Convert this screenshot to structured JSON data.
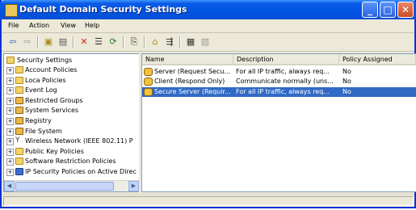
{
  "window": {
    "title": "Default Domain Security Settings",
    "minimize_label": "_",
    "maximize_label": "□",
    "close_label": "✕"
  },
  "menu": {
    "items": [
      "File",
      "Action",
      "View",
      "Help"
    ]
  },
  "toolbar": {
    "icons": [
      "back-arrow-icon",
      "forward-arrow-icon",
      "up-folder-icon",
      "show-hide-tree-icon",
      "delete-icon",
      "properties-icon",
      "refresh-icon",
      "export-list-icon",
      "help-icon",
      "add-policy-icon",
      "assign-policy-icon",
      "manage-filters-icon",
      "unassign-icon"
    ]
  },
  "tree": {
    "root": "Security Settings",
    "items": [
      {
        "label": "Account Policies",
        "icon": "folder",
        "expand": "+"
      },
      {
        "label": "Loca Policies",
        "icon": "folder",
        "expand": "+"
      },
      {
        "label": "Event Log",
        "icon": "folder",
        "expand": "+"
      },
      {
        "label": "Restricted Groups",
        "icon": "policy",
        "expand": "+"
      },
      {
        "label": "System Services",
        "icon": "policy",
        "expand": "+"
      },
      {
        "label": "Registry",
        "icon": "policy",
        "expand": "+"
      },
      {
        "label": "File System",
        "icon": "policy",
        "expand": "+"
      },
      {
        "label": "Wireless Network (IEEE 802.11) P",
        "icon": "antenna",
        "expand": "+"
      },
      {
        "label": "Public Key Policies",
        "icon": "folder",
        "expand": "+"
      },
      {
        "label": "Software Restriction Policies",
        "icon": "folder",
        "expand": "+"
      },
      {
        "label": "IP Security Policies on Active Direc",
        "icon": "ipsec",
        "expand": "+"
      }
    ]
  },
  "list": {
    "columns": [
      "Name",
      "Description",
      "Policy Assigned"
    ],
    "rows": [
      {
        "name": "Server (Request Secu...",
        "description": "For all IP traffic, always req...",
        "assigned": "No",
        "selected": false
      },
      {
        "name": "Client (Respond Only)",
        "description": "Communicate normally (uns...",
        "assigned": "No",
        "selected": false
      },
      {
        "name": "Secure Server (Requir...",
        "description": "For all IP traffic, always req...",
        "assigned": "No",
        "selected": true
      }
    ]
  },
  "colors": {
    "selection": "#316ac5",
    "titlebar": "#0054e3",
    "chrome": "#ece9d8"
  }
}
